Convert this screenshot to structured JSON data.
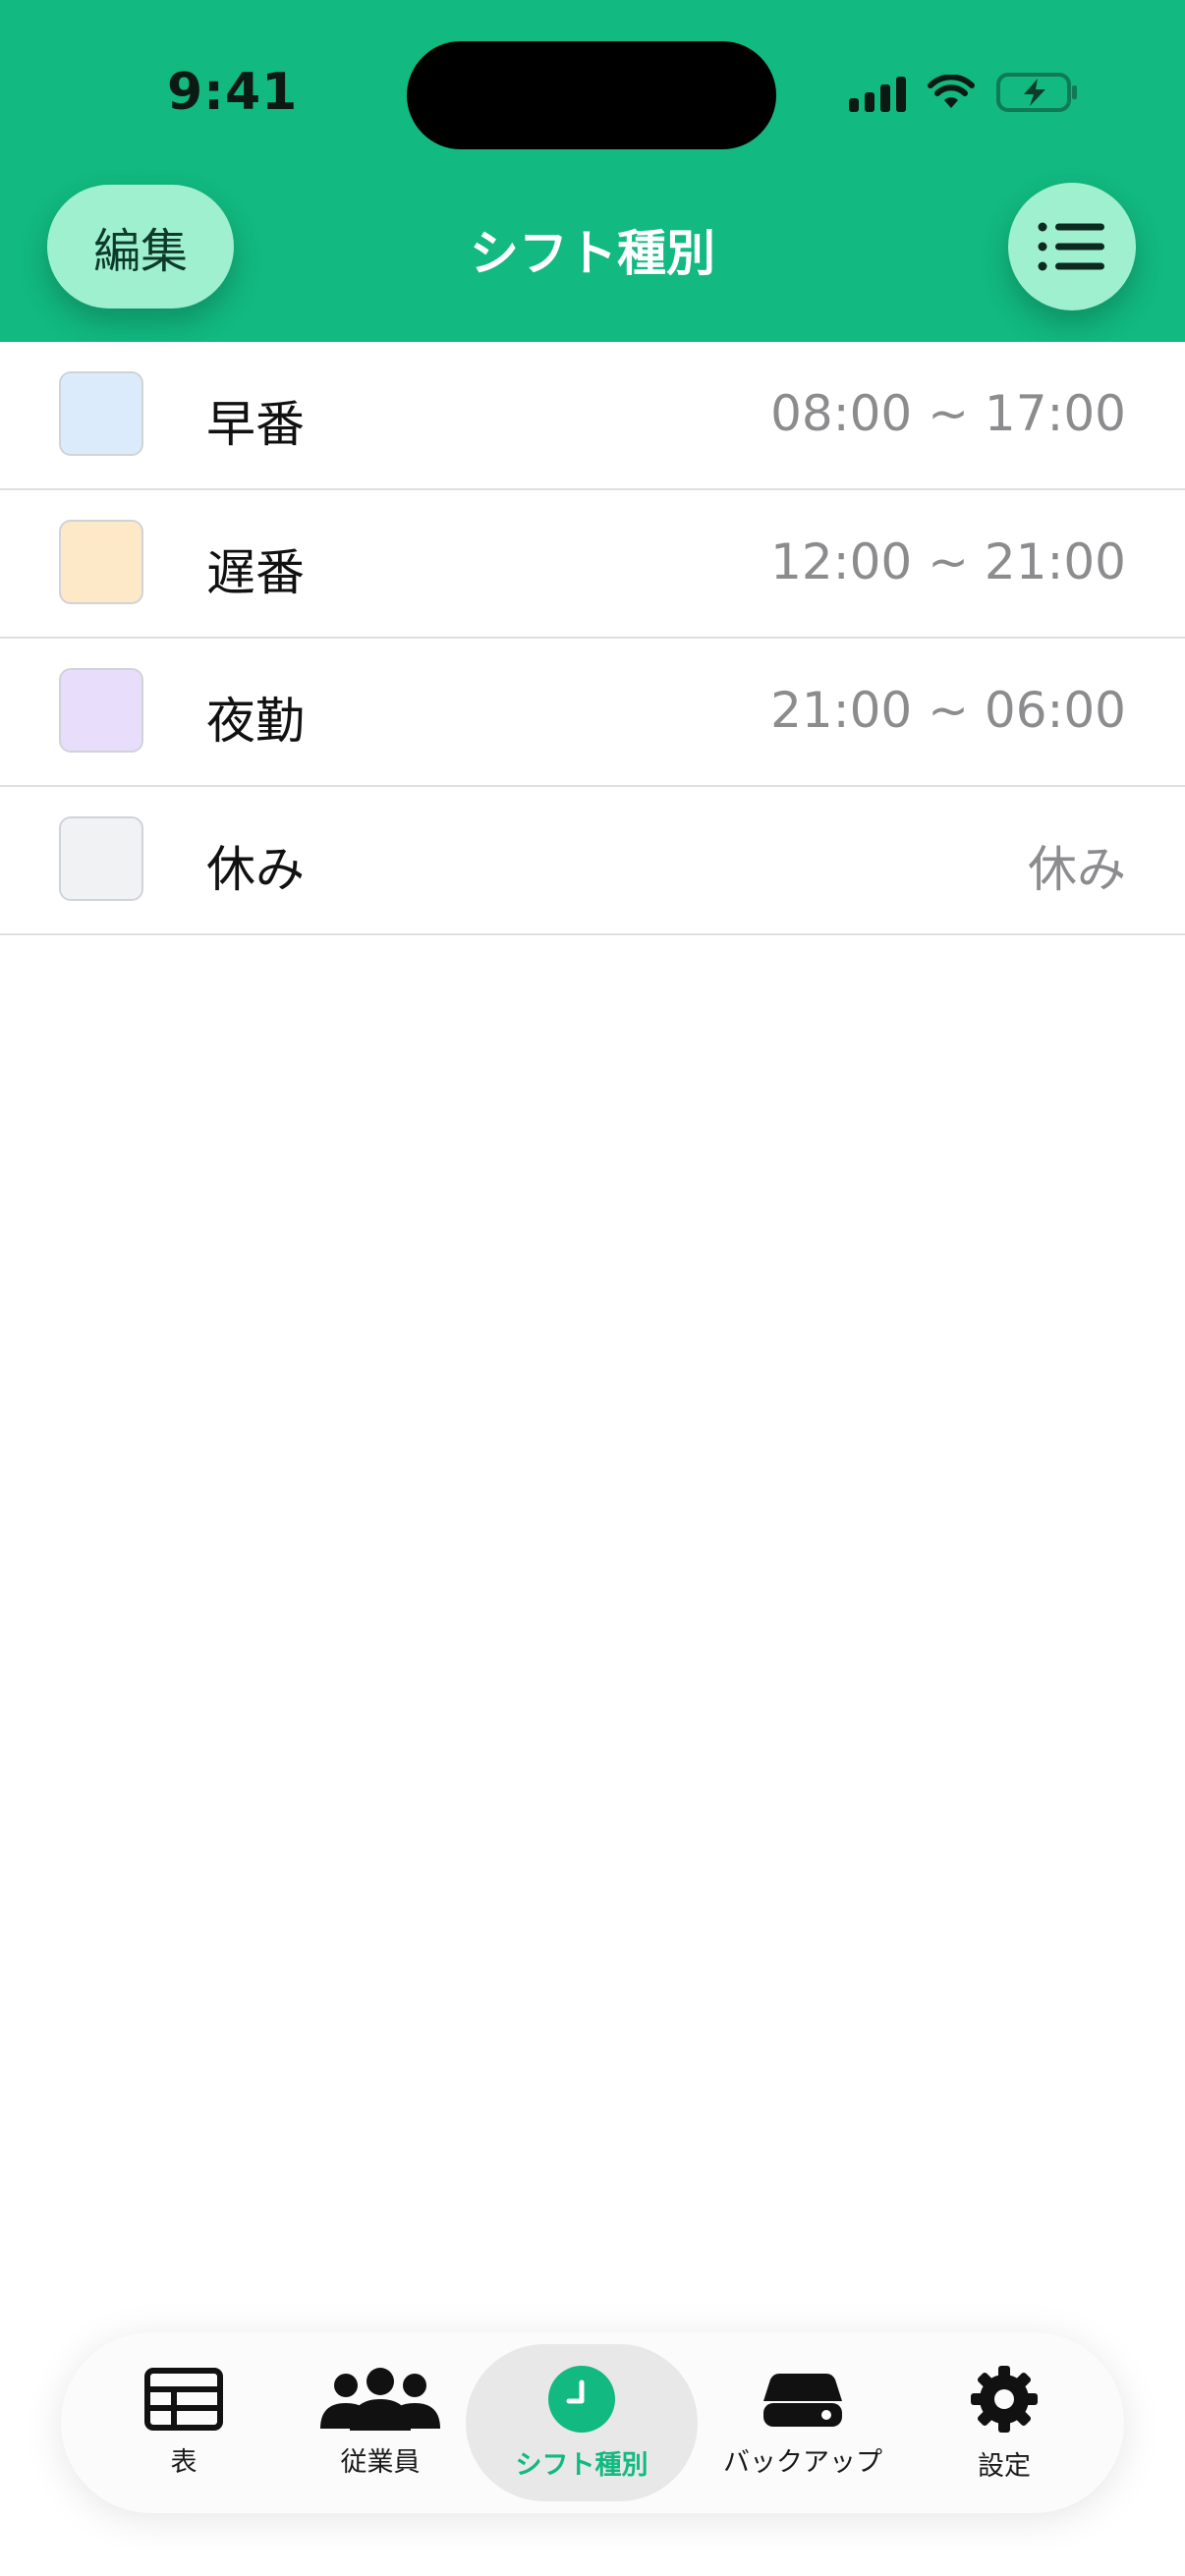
{
  "status_bar": {
    "time": "9:41"
  },
  "header": {
    "edit_label": "編集",
    "title": "シフト種別",
    "list_icon": "list-icon"
  },
  "colors": {
    "accent": "#12b981",
    "button_bg": "#9ef0cf"
  },
  "shifts": [
    {
      "name": "早番",
      "time": "08:00 ~ 17:00",
      "color": "#dcebfb"
    },
    {
      "name": "遅番",
      "time": "12:00 ~ 21:00",
      "color": "#fde8c7"
    },
    {
      "name": "夜勤",
      "time": "21:00 ~ 06:00",
      "color": "#e8defc"
    },
    {
      "name": "休み",
      "time": "休み",
      "color": "#f1f2f4"
    }
  ],
  "tabs": [
    {
      "label": "表",
      "icon": "table-icon"
    },
    {
      "label": "従業員",
      "icon": "people-icon"
    },
    {
      "label": "シフト種別",
      "icon": "clock-icon",
      "active": true
    },
    {
      "label": "バックアップ",
      "icon": "drive-icon"
    },
    {
      "label": "設定",
      "icon": "gear-icon"
    }
  ]
}
